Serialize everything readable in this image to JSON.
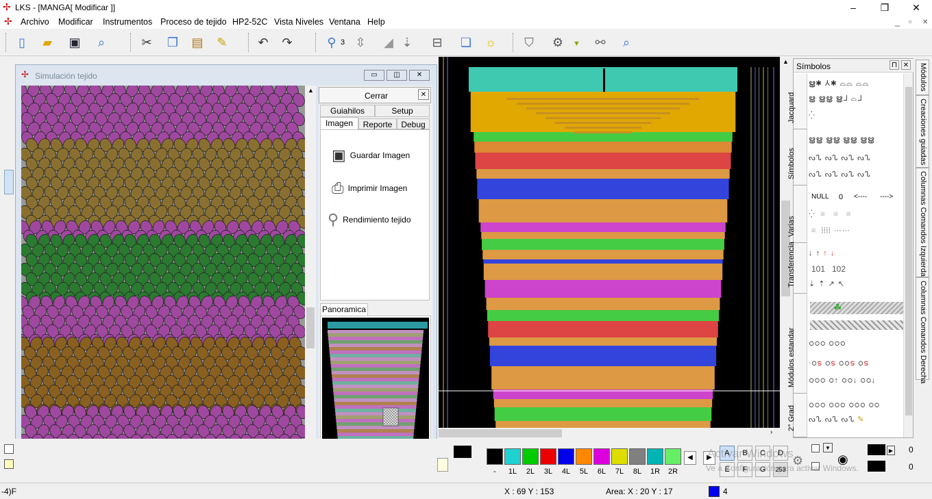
{
  "window": {
    "title": "LKS - [MANGA[ Modificar ]]",
    "minimize": "–",
    "maximize": "❐",
    "close": "✕"
  },
  "menu": [
    "Archivo",
    "Modificar",
    "Instrumentos",
    "Proceso de tejido",
    "HP2-52C",
    "Vista Niveles",
    "Ventana",
    "Help"
  ],
  "mdi_controls": [
    "_",
    "▫",
    "✕"
  ],
  "toolbar": {
    "zoom_label": "3",
    "icons": [
      "new-icon",
      "open-icon",
      "save-icon",
      "preview-icon",
      "cut-icon",
      "copy-icon",
      "paste-icon",
      "paste-special-icon",
      "undo-icon",
      "redo-icon",
      "zoom-icon",
      "up-down-icon",
      "grid-icon",
      "arrow-icon",
      "machine-icon",
      "windows-icon",
      "bulb-icon",
      "shirt-icon",
      "gear-icon",
      "binoculars-icon",
      "find-icon"
    ]
  },
  "simulation": {
    "title": "Simulación tejido",
    "close_label": "Cerrar",
    "tabs_top": [
      "Guiahilos",
      "Setup"
    ],
    "tabs_bottom": [
      "Imagen",
      "Reporte",
      "Debug"
    ],
    "actions": [
      "Guardar Imagen",
      "Imprimir Imagen",
      "Rendimiento tejido"
    ],
    "panoramic_tab": "Panoramica"
  },
  "symbols": {
    "title": "Símbolos",
    "categories": [
      "Jacquard",
      "Símbolos",
      "Varias",
      "Transferencia",
      "Módulos estandar",
      "2° Grad"
    ],
    "varias_row1": [
      "NULL",
      "0",
      "<----",
      "---->"
    ],
    "transfer_row": [
      "101",
      "102"
    ]
  },
  "side_tabs": [
    "Módulos",
    "Creaciones guiadas",
    "Columnas Comandos Izquierda",
    "Columnas Comandos Derecha"
  ],
  "palette": {
    "labels": [
      "-",
      "1L",
      "2L",
      "3L",
      "4L",
      "5L",
      "6L",
      "7L",
      "8L",
      "1R",
      "2R"
    ],
    "colors": [
      "#000000",
      "#1ed2d2",
      "#00cc00",
      "#ee0000",
      "#0000ee",
      "#ff8800",
      "#dd00dd",
      "#dddd00",
      "#808080",
      "#00b4b4",
      "#66ee66"
    ],
    "letters": [
      "A",
      "B",
      "C",
      "D",
      "E",
      "F",
      "G",
      "253"
    ],
    "count_a": "0",
    "count_b": "0"
  },
  "watermark": {
    "line1": "Activar Windows",
    "line2": "Ve a Configuración para activar Windows."
  },
  "status": {
    "left": "-4)F",
    "coords": "X : 69  Y : 153",
    "area": "Area: X : 20   Y : 17",
    "color_index": "4"
  }
}
